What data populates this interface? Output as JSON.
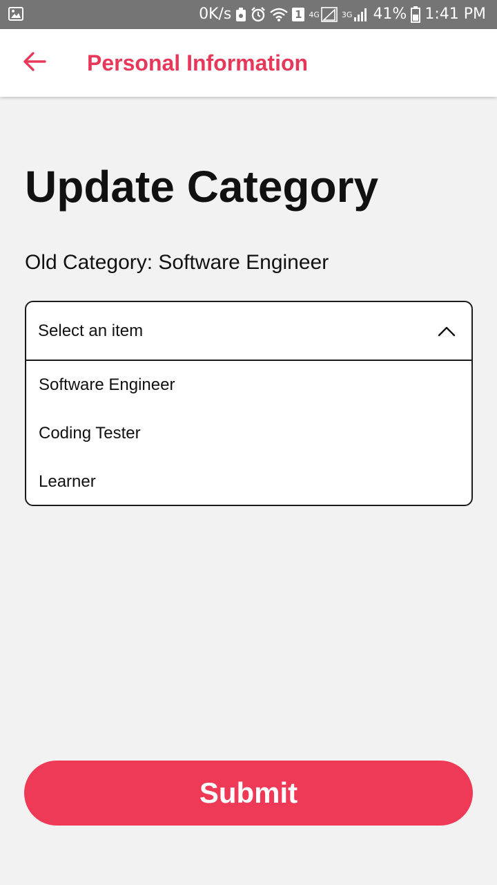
{
  "status_bar": {
    "network_speed": "0K/s",
    "sim_badge": "1",
    "net_4g": "4G",
    "net_3g": "3G",
    "battery": "41%",
    "time": "1:41 PM",
    "icons": [
      "image-icon",
      "recycle-icon",
      "alarm-icon",
      "wifi-icon",
      "signal-4g-icon",
      "signal-3g-icon",
      "battery-icon"
    ]
  },
  "app_bar": {
    "title": "Personal Information",
    "back_icon": "back-arrow-icon",
    "accent_color": "#e8385a"
  },
  "page": {
    "title": "Update Category",
    "old_category_label": "Old Category: Software Engineer"
  },
  "dropdown": {
    "placeholder": "Select an item",
    "expanded": true,
    "options": [
      {
        "label": "Software Engineer"
      },
      {
        "label": "Coding Tester"
      },
      {
        "label": "Learner"
      }
    ]
  },
  "submit": {
    "label": "Submit",
    "color": "#ef3a57"
  }
}
